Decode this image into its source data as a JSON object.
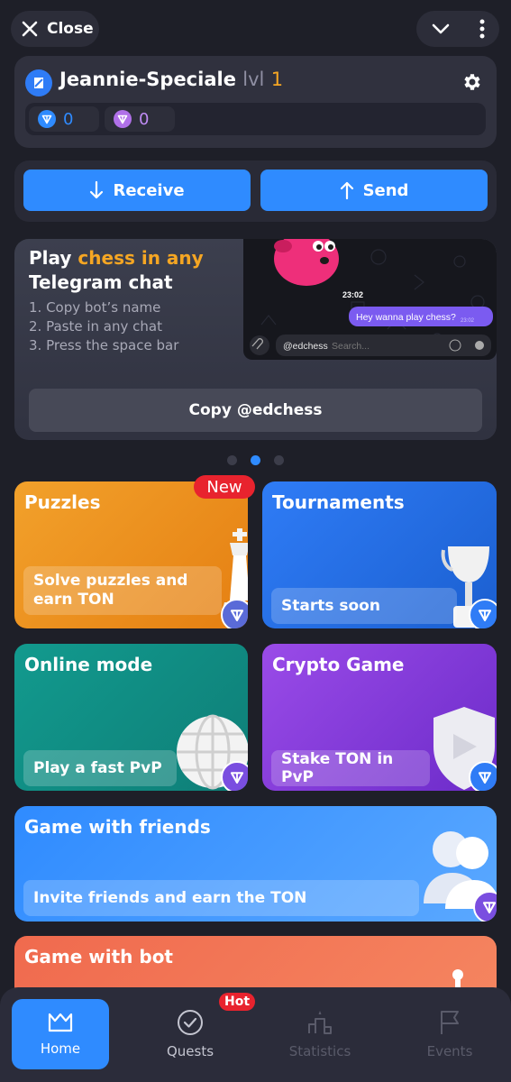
{
  "topbar": {
    "close_label": "Close"
  },
  "profile": {
    "username": "Jeannie-Speciale",
    "lvl_label": "lvl",
    "level": "1",
    "balances": [
      {
        "value": "0"
      },
      {
        "value": "0"
      }
    ]
  },
  "actions": {
    "receive": "Receive",
    "send": "Send"
  },
  "promo": {
    "title_pre": "Play ",
    "title_highlight": "chess in any",
    "title_post": "Telegram chat",
    "steps": [
      "1. Copy bot’s name",
      "2. Paste in any chat",
      "3. Press the space bar"
    ],
    "copy_button": "Copy @edchess",
    "chat_time": "23:02",
    "chat_message": "Hey wanna play chess?",
    "chat_message_time": "23:02",
    "chat_input_text": "@edchess",
    "chat_input_placeholder": "Search...",
    "carousel_active_index": 1
  },
  "tiles": {
    "puzzles": {
      "title": "Puzzles",
      "sub": "Solve puzzles and earn TON",
      "badge": "New"
    },
    "tournaments": {
      "title": "Tournaments",
      "sub": "Starts soon"
    },
    "online": {
      "title": "Online mode",
      "sub": "Play a fast PvP"
    },
    "crypto": {
      "title": "Crypto Game",
      "sub": "Stake TON in PvP"
    },
    "friends": {
      "title": "Game with friends",
      "sub": "Invite friends and earn the TON"
    },
    "bot": {
      "title": "Game with bot"
    }
  },
  "nav": {
    "home": "Home",
    "quests": "Quests",
    "quests_badge": "Hot",
    "statistics": "Statistics",
    "events": "Events"
  },
  "colors": {
    "accent": "#2f8bff",
    "background": "#1e1f28",
    "orange": "#f5a623",
    "red_badge": "#e8232e"
  }
}
